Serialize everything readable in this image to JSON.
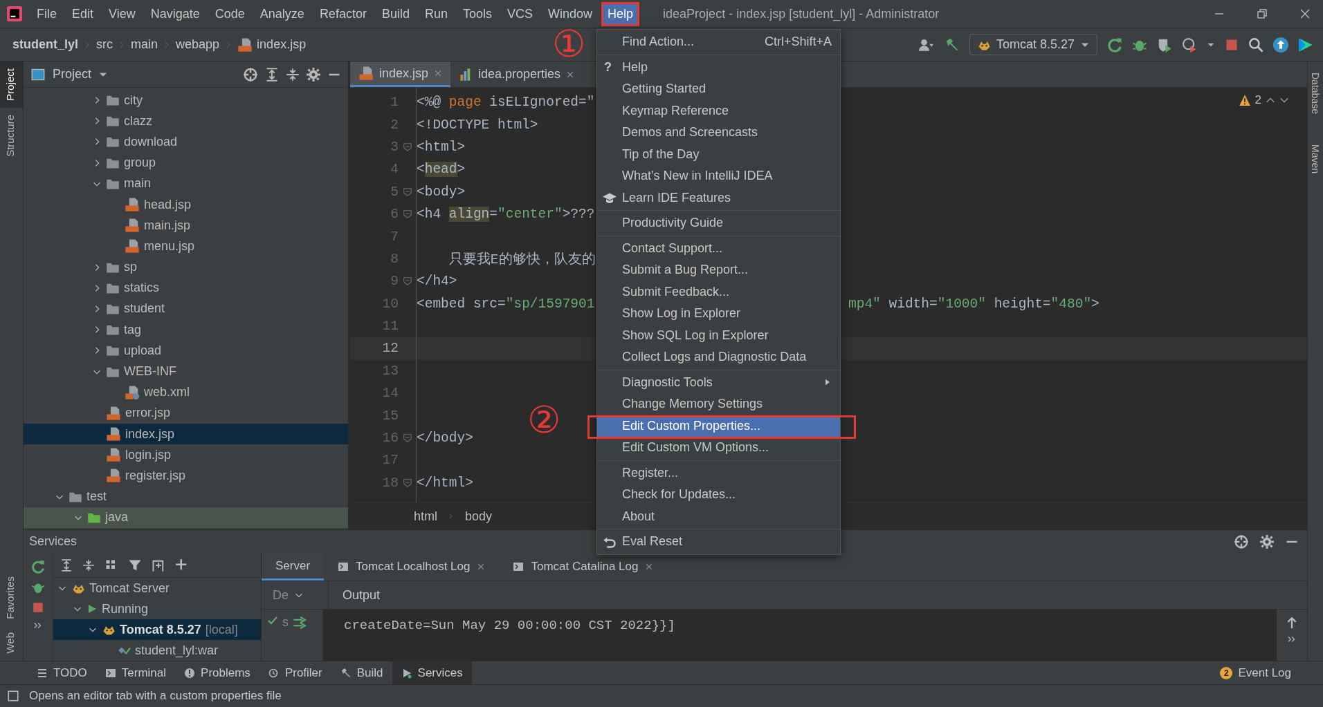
{
  "window": {
    "title": "ideaProject - index.jsp [student_lyl] - Administrator"
  },
  "menu_bar": [
    {
      "label": "File",
      "selected": false
    },
    {
      "label": "Edit",
      "selected": false
    },
    {
      "label": "View",
      "selected": false
    },
    {
      "label": "Navigate",
      "selected": false
    },
    {
      "label": "Code",
      "selected": false
    },
    {
      "label": "Analyze",
      "selected": false
    },
    {
      "label": "Refactor",
      "selected": false
    },
    {
      "label": "Build",
      "selected": false
    },
    {
      "label": "Run",
      "selected": false
    },
    {
      "label": "Tools",
      "selected": false
    },
    {
      "label": "VCS",
      "selected": false
    },
    {
      "label": "Window",
      "selected": false
    },
    {
      "label": "Help",
      "selected": true,
      "annotated": true
    }
  ],
  "breadcrumb": [
    {
      "label": "student_lyl",
      "kind": "project"
    },
    {
      "label": "src",
      "kind": "dir"
    },
    {
      "label": "main",
      "kind": "dir"
    },
    {
      "label": "webapp",
      "kind": "dir"
    },
    {
      "label": "index.jsp",
      "kind": "jsp"
    }
  ],
  "run_config": {
    "label": "Tomcat 8.5.27"
  },
  "left_stripe": [
    {
      "label": "Project",
      "selected": true
    },
    {
      "label": "Structure",
      "selected": false
    }
  ],
  "left_stripe_bottom": [
    {
      "label": "Favorites",
      "selected": false
    },
    {
      "label": "Web",
      "selected": false
    }
  ],
  "project_panel": {
    "title": "Project",
    "tree": [
      {
        "children": [
          {
            "children": [
              {
                "label": "city",
                "kind": "folder",
                "expanded": false,
                "selected": false
              },
              {
                "label": "clazz",
                "kind": "folder",
                "expanded": false,
                "selected": false
              },
              {
                "label": "download",
                "kind": "folder",
                "expanded": false,
                "selected": false
              },
              {
                "label": "group",
                "kind": "folder",
                "expanded": false,
                "selected": false
              },
              {
                "label": "main",
                "kind": "folder",
                "expanded": true,
                "selected": false,
                "children": [
                  {
                    "label": "head.jsp",
                    "kind": "jsp",
                    "selected": false
                  },
                  {
                    "label": "main.jsp",
                    "kind": "jsp",
                    "selected": false
                  },
                  {
                    "label": "menu.jsp",
                    "kind": "jsp",
                    "selected": false
                  }
                ]
              },
              {
                "label": "sp",
                "kind": "folder",
                "expanded": false,
                "selected": false
              },
              {
                "label": "statics",
                "kind": "folder",
                "expanded": false,
                "selected": false
              },
              {
                "label": "student",
                "kind": "folder",
                "expanded": false,
                "selected": false
              },
              {
                "label": "tag",
                "kind": "folder",
                "expanded": false,
                "selected": false
              },
              {
                "label": "upload",
                "kind": "folder",
                "expanded": false,
                "selected": false
              },
              {
                "label": "WEB-INF",
                "kind": "folder",
                "expanded": true,
                "selected": false,
                "children": [
                  {
                    "label": "web.xml",
                    "kind": "xml",
                    "selected": false
                  }
                ]
              },
              {
                "label": "error.jsp",
                "kind": "jsp",
                "selected": false
              },
              {
                "label": "index.jsp",
                "kind": "jsp",
                "selected": true
              },
              {
                "label": "login.jsp",
                "kind": "jsp",
                "selected": false
              },
              {
                "label": "register.jsp",
                "kind": "jsp",
                "selected": false
              }
            ]
          }
        ]
      },
      {
        "label": "test",
        "kind": "folder",
        "expanded": true,
        "selected": false,
        "children": [
          {
            "label": "java",
            "kind": "test_root",
            "expanded": true,
            "selected": false
          }
        ]
      }
    ]
  },
  "editor": {
    "tabs": [
      {
        "label": "index.jsp",
        "kind": "jsp",
        "selected": true
      },
      {
        "label": "idea.properties",
        "kind": "properties",
        "selected": false
      }
    ],
    "warnings": "2",
    "lines": [
      {
        "number": "1",
        "fold": false,
        "current": false,
        "left": [
          {
            "text": "<%@ ",
            "kind": "plain"
          },
          {
            "text": "page",
            "kind": "keyword"
          },
          {
            "text": " isELIgnored=\"",
            "kind": "plain"
          }
        ]
      },
      {
        "number": "2",
        "fold": false,
        "current": false,
        "left": [
          {
            "text": "<!DOCTYPE html>",
            "kind": "plain"
          }
        ]
      },
      {
        "number": "3",
        "fold": true,
        "current": false,
        "left": [
          {
            "text": "<html>",
            "kind": "plain"
          }
        ]
      },
      {
        "number": "4",
        "fold": false,
        "current": false,
        "left": [
          {
            "text": "<",
            "kind": "plain"
          },
          {
            "text": "head",
            "kind": "match"
          },
          {
            "text": ">",
            "kind": "plain"
          }
        ]
      },
      {
        "number": "5",
        "fold": true,
        "current": false,
        "left": [
          {
            "text": "<body>",
            "kind": "plain"
          }
        ]
      },
      {
        "number": "6",
        "fold": true,
        "current": false,
        "left": [
          {
            "text": "<h4 ",
            "kind": "plain"
          },
          {
            "text": "align",
            "kind": "match"
          },
          {
            "text": "=",
            "kind": "plain"
          },
          {
            "text": "\"center\"",
            "kind": "string"
          },
          {
            "text": ">???",
            "kind": "plain"
          }
        ]
      },
      {
        "number": "7",
        "fold": false,
        "current": false
      },
      {
        "number": "8",
        "fold": false,
        "current": false,
        "left": [
          {
            "text": "    只要我E的够快，队友的",
            "kind": "plain"
          }
        ]
      },
      {
        "number": "9",
        "fold": true,
        "current": false,
        "left": [
          {
            "text": "</h4>",
            "kind": "plain"
          }
        ]
      },
      {
        "number": "10",
        "fold": false,
        "current": false,
        "left": [
          {
            "text": "<embed src=",
            "kind": "plain"
          },
          {
            "text": "\"sp/1597901",
            "kind": "string"
          }
        ],
        "right": [
          {
            "text": "mp4\"",
            "kind": "string"
          },
          {
            "text": " width=",
            "kind": "plain"
          },
          {
            "text": "\"1000\"",
            "kind": "string"
          },
          {
            "text": " height=",
            "kind": "plain"
          },
          {
            "text": "\"480\"",
            "kind": "string"
          },
          {
            "text": ">",
            "kind": "plain"
          }
        ]
      },
      {
        "number": "11",
        "fold": false,
        "current": false
      },
      {
        "number": "12",
        "fold": false,
        "current": true
      },
      {
        "number": "13",
        "fold": false,
        "current": false
      },
      {
        "number": "14",
        "fold": false,
        "current": false
      },
      {
        "number": "15",
        "fold": false,
        "current": false
      },
      {
        "number": "16",
        "fold": true,
        "current": false,
        "left": [
          {
            "text": "</body>",
            "kind": "plain"
          }
        ]
      },
      {
        "number": "17",
        "fold": false,
        "current": false
      },
      {
        "number": "18",
        "fold": true,
        "current": false,
        "left": [
          {
            "text": "</html>",
            "kind": "plain"
          }
        ]
      }
    ],
    "breadcrumb": [
      "html",
      "body"
    ]
  },
  "right_stripe": [
    {
      "label": "Database",
      "selected": false
    },
    {
      "label": "Maven",
      "selected": false
    }
  ],
  "help_menu": {
    "groups": [
      [
        {
          "label": "Find Action...",
          "shortcut": "Ctrl+Shift+A",
          "selected": false
        }
      ],
      [
        {
          "label": "Help",
          "icon_text": "?",
          "selected": false
        },
        {
          "label": "Getting Started",
          "selected": false
        },
        {
          "label": "Keymap Reference",
          "selected": false
        },
        {
          "label": "Demos and Screencasts",
          "selected": false
        },
        {
          "label": "Tip of the Day",
          "selected": false
        },
        {
          "label": "What's New in IntelliJ IDEA",
          "selected": false
        },
        {
          "label": "Learn IDE Features",
          "kind": "learn",
          "selected": false
        }
      ],
      [
        {
          "label": "Productivity Guide",
          "selected": false
        }
      ],
      [
        {
          "label": "Contact Support...",
          "selected": false
        },
        {
          "label": "Submit a Bug Report...",
          "selected": false
        },
        {
          "label": "Submit Feedback...",
          "selected": false
        },
        {
          "label": "Show Log in Explorer",
          "selected": false
        },
        {
          "label": "Show SQL Log in Explorer",
          "selected": false
        },
        {
          "label": "Collect Logs and Diagnostic Data",
          "selected": false
        }
      ],
      [
        {
          "label": "Diagnostic Tools",
          "submenu": true,
          "selected": false
        },
        {
          "label": "Change Memory Settings",
          "selected": false
        },
        {
          "label": "Edit Custom Properties...",
          "selected": true,
          "annotated": true
        },
        {
          "label": "Edit Custom VM Options...",
          "selected": false
        }
      ],
      [
        {
          "label": "Register...",
          "selected": false
        },
        {
          "label": "Check for Updates...",
          "selected": false
        },
        {
          "label": "About",
          "selected": false
        }
      ],
      [
        {
          "label": "Eval Reset",
          "kind": "reset",
          "selected": false
        }
      ]
    ]
  },
  "services": {
    "title": "Services",
    "tree": [
      {
        "label": "Tomcat Server",
        "kind": "server",
        "expanded": true,
        "selected": false,
        "children": [
          {
            "label": "Running",
            "kind": "running",
            "expanded": true,
            "selected": false,
            "children": [
              {
                "label": "Tomcat 8.5.27",
                "suffix": "[local]",
                "kind": "tomcat",
                "expanded": true,
                "selected": true,
                "children": [
                  {
                    "label": "student_lyl:war",
                    "kind": "artifact",
                    "selected": false
                  }
                ]
              }
            ]
          }
        ]
      }
    ],
    "tabs": [
      {
        "label": "Server",
        "selected": true,
        "closable": false
      },
      {
        "label": "Tomcat Localhost Log",
        "selected": false,
        "closable": true
      },
      {
        "label": "Tomcat Catalina Log",
        "selected": false,
        "closable": true
      }
    ],
    "deploy_label": "De",
    "deploy_item": "s",
    "output_title": "Output",
    "output": "createDate=Sun May 29 00:00:00 CST 2022}}]"
  },
  "tool_tabs": [
    {
      "label": "TODO",
      "kind": "todo",
      "selected": false
    },
    {
      "label": "Terminal",
      "kind": "terminal",
      "selected": false
    },
    {
      "label": "Problems",
      "kind": "problems",
      "selected": false
    },
    {
      "label": "Profiler",
      "kind": "profiler",
      "selected": false
    },
    {
      "label": "Build",
      "kind": "build",
      "selected": false
    },
    {
      "label": "Services",
      "kind": "services",
      "selected": true
    }
  ],
  "event_log": {
    "label": "Event Log",
    "count": "2"
  },
  "status_bar": {
    "text": "Opens an editor tab with a custom properties file"
  },
  "annotations": [
    {
      "text": "①"
    },
    {
      "text": "②"
    }
  ]
}
